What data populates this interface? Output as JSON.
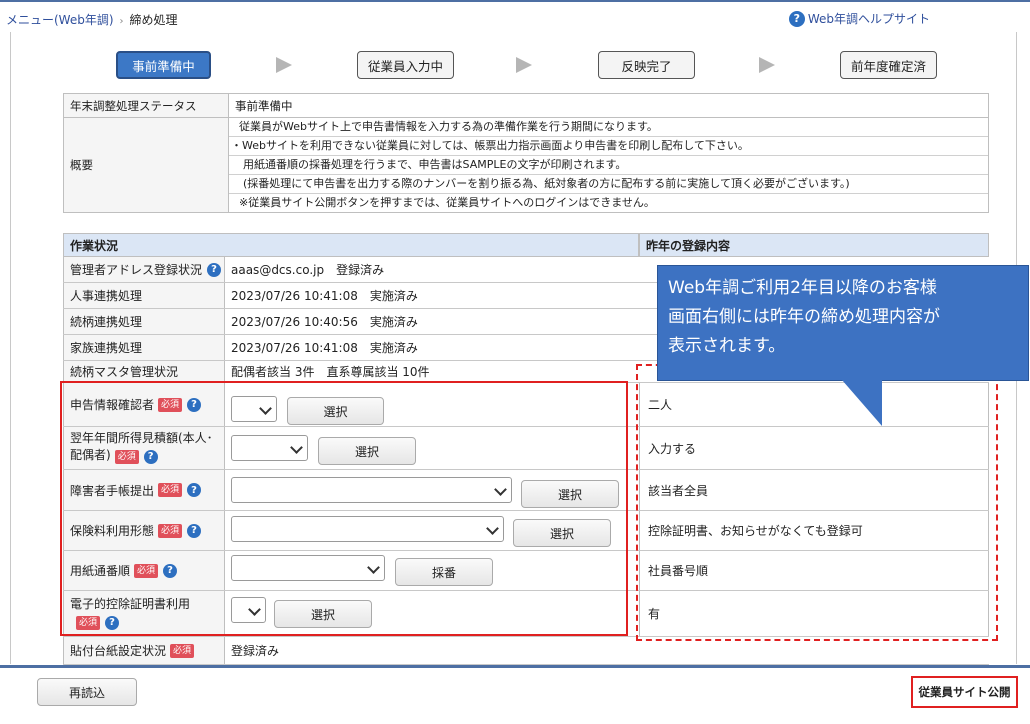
{
  "breadcrumb": {
    "home": "メニュー(Web年調)",
    "current": "締め処理"
  },
  "help_link": "Web年調ヘルプサイト",
  "steps": [
    "事前準備中",
    "従業員入力中",
    "反映完了",
    "前年度確定済"
  ],
  "status": {
    "label": "年末調整処理ステータス",
    "value": "事前準備中"
  },
  "overview": {
    "label": "概要",
    "lines": [
      "従業員がWebサイト上で申告書情報を入力する為の準備作業を行う期間になります。",
      "・Webサイトを利用できない従業員に対しては、帳票出力指示画面より申告書を印刷し配布して下さい。",
      "用紙通番順の採番処理を行うまで、申告書はSAMPLEの文字が印刷されます。",
      "(採番処理にて申告書を出力する際のナンバーを割り振る為、紙対象者の方に配布する前に実施して頂く必要がございます。)",
      "※従業員サイト公開ボタンを押すまでは、従業員サイトへのログインはできません。"
    ]
  },
  "work": {
    "header_left": "作業状況",
    "header_right": "昨年の登録内容",
    "rows": [
      {
        "label": "管理者アドレス登録状況",
        "value": "aaas@dcs.co.jp　登録済み"
      },
      {
        "label": "人事連携処理",
        "value": "2023/07/26 10:41:08　実施済み"
      },
      {
        "label": "続柄連携処理",
        "value": "2023/07/26 10:40:56　実施済み"
      },
      {
        "label": "家族連携処理",
        "value": "2023/07/26 10:41:08　実施済み"
      },
      {
        "label": "続柄マスタ管理状況",
        "value": "配偶者該当 3件　直系尊属該当 10件"
      }
    ],
    "form_rows": [
      {
        "label": "申告情報確認者",
        "button": "選択",
        "last_year": "二人"
      },
      {
        "label": "翌年年間所得見積額(本人･配偶者)",
        "button": "選択",
        "last_year": "入力する"
      },
      {
        "label": "障害者手帳提出",
        "button": "選択",
        "last_year": "該当者全員"
      },
      {
        "label": "保険料利用形態",
        "button": "選択",
        "last_year": "控除証明書、お知らせがなくても登録可"
      },
      {
        "label": "用紙通番順",
        "button": "採番",
        "last_year": "社員番号順"
      },
      {
        "label": "電子的控除証明書利用",
        "button": "選択",
        "last_year": "有"
      }
    ],
    "paste": {
      "label": "貼付台紙設定状況",
      "value": "登録済み"
    }
  },
  "required_badge": "必須",
  "callout": {
    "line1": "Web年調ご利用2年目以降のお客様",
    "line2": "画面右側には昨年の締め処理内容が",
    "line3": "表示されます。"
  },
  "footer": {
    "reload": "再読込",
    "publish": "従業員サイト公開"
  },
  "colors": {
    "accent": "#3c78c6",
    "highlight": "#e02020",
    "required": "#e0505a"
  }
}
